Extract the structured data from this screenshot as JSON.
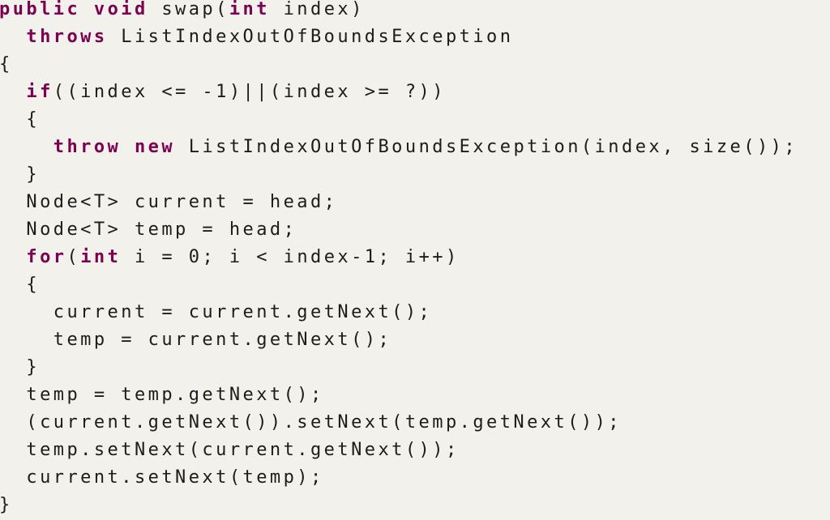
{
  "colors": {
    "background": "#f2f1eb",
    "keyword": "#7b0052",
    "text": "#1c1c1c"
  },
  "code": {
    "language": "java",
    "lines": [
      [
        {
          "t": "public",
          "kw": true
        },
        {
          "t": " "
        },
        {
          "t": "void",
          "kw": true
        },
        {
          "t": " swap("
        },
        {
          "t": "int",
          "kw": true
        },
        {
          "t": " index)"
        }
      ],
      [
        {
          "t": "  "
        },
        {
          "t": "throws",
          "kw": true
        },
        {
          "t": " ListIndexOutOfBoundsException"
        }
      ],
      [
        {
          "t": "{"
        }
      ],
      [
        {
          "t": "  "
        },
        {
          "t": "if",
          "kw": true
        },
        {
          "t": "((index <= -1)||(index >= ?))"
        }
      ],
      [
        {
          "t": "  {"
        }
      ],
      [
        {
          "t": "    "
        },
        {
          "t": "throw",
          "kw": true
        },
        {
          "t": " "
        },
        {
          "t": "new",
          "kw": true
        },
        {
          "t": " ListIndexOutOfBoundsException(index, size());"
        }
      ],
      [
        {
          "t": "  }"
        }
      ],
      [
        {
          "t": "  Node<T> current = head;"
        }
      ],
      [
        {
          "t": "  Node<T> temp = head;"
        }
      ],
      [
        {
          "t": "  "
        },
        {
          "t": "for",
          "kw": true
        },
        {
          "t": "("
        },
        {
          "t": "int",
          "kw": true
        },
        {
          "t": " i = 0; i < index-1; i++)"
        }
      ],
      [
        {
          "t": "  {"
        }
      ],
      [
        {
          "t": "    current = current.getNext();"
        }
      ],
      [
        {
          "t": "    temp = current.getNext();"
        }
      ],
      [
        {
          "t": "  }"
        }
      ],
      [
        {
          "t": "  temp = temp.getNext();"
        }
      ],
      [
        {
          "t": "  (current.getNext()).setNext(temp.getNext());"
        }
      ],
      [
        {
          "t": "  temp.setNext(current.getNext());"
        }
      ],
      [
        {
          "t": "  current.setNext(temp);"
        }
      ],
      [
        {
          "t": "}"
        }
      ]
    ]
  }
}
